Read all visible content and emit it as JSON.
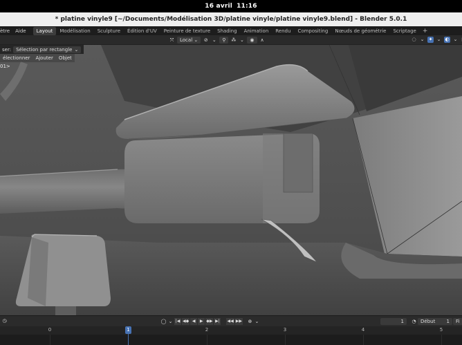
{
  "os_bar": {
    "date": "16 avril",
    "time": "11:16"
  },
  "window": {
    "title": "* platine vinyle9 [~/Documents/Modélisation 3D/platine vinyle/platine vinyle9.blend] - Blender 5.0.1"
  },
  "menu": {
    "partial_left": "ètre",
    "help": "Aide"
  },
  "workspace_tabs": [
    {
      "label": "Layout",
      "active": true
    },
    {
      "label": "Modélisation",
      "active": false
    },
    {
      "label": "Sculpture",
      "active": false
    },
    {
      "label": "Édition d'UV",
      "active": false
    },
    {
      "label": "Peinture de texture",
      "active": false
    },
    {
      "label": "Shading",
      "active": false
    },
    {
      "label": "Animation",
      "active": false
    },
    {
      "label": "Rendu",
      "active": false
    },
    {
      "label": "Compositing",
      "active": false
    },
    {
      "label": "Nœuds de géométrie",
      "active": false
    },
    {
      "label": "Scriptage",
      "active": false
    }
  ],
  "add_workspace": "+",
  "viewport_header": {
    "transform_orientation": "Local",
    "pivot_icon": "pivot-icon",
    "snap_icon": "snap-icon",
    "proportional_icon": "proportional-edit-icon"
  },
  "tool_header": {
    "select_label": "ser:",
    "select_mode": "Sélection par rectangle"
  },
  "viewport_menu": [
    "électionner",
    "Ajouter",
    "Objet"
  ],
  "viewport_overlay_text": "01>",
  "timeline": {
    "current_frame": "1",
    "start_label": "Début",
    "start_value": "1",
    "end_label_partial": "Fi",
    "ruler_ticks": [
      "0",
      "1",
      "2",
      "3",
      "4",
      "5"
    ],
    "playhead": "1"
  },
  "colors": {
    "accent": "#4772b3",
    "viewport_bg": "#4b4b4b",
    "header_bg": "#2a2a2a"
  }
}
